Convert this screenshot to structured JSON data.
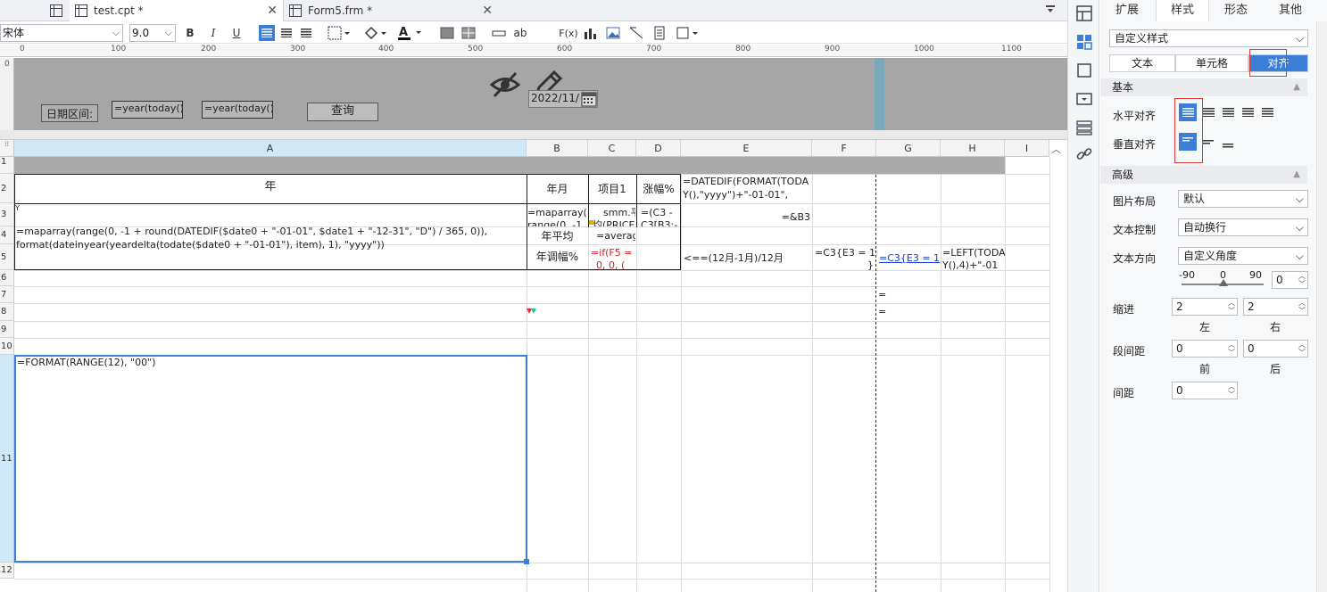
{
  "tabs": [
    {
      "label": "test.cpt *",
      "active": true
    },
    {
      "label": "Form5.frm *",
      "active": false
    }
  ],
  "toolbar": {
    "font_name": "宋体",
    "font_size": "9.0",
    "bold": "B",
    "italic": "I",
    "underline": "U",
    "text_tool": "ab",
    "formula_tool": "F(x)"
  },
  "ruler": {
    "marks": [
      "0",
      "100",
      "200",
      "300",
      "400",
      "500",
      "600",
      "700",
      "800",
      "900",
      "1000",
      "1100"
    ],
    "vmark": "0"
  },
  "parameter_pane": {
    "date_label": "日期区间:",
    "start_field": "=year(today()",
    "end_field": "=year(today()",
    "query_button": "查询",
    "date_widget_value": "2022/11/"
  },
  "sheet": {
    "columns": [
      "A",
      "B",
      "C",
      "D",
      "E",
      "F",
      "G",
      "H",
      "I"
    ],
    "rows": [
      "1",
      "2",
      "3",
      "4",
      "5",
      "6",
      "7",
      "8",
      "9",
      "10",
      "11",
      "12"
    ],
    "cells": {
      "a2": "年",
      "b2": "年月",
      "c2": "项目1",
      "d2": "涨幅%",
      "e2_l1": "=DATEDIF(FORMAT(TODA",
      "e2_l2": "Y(),\"yyyy\")+\"-01-01\",",
      "a3_mark": "Y",
      "a3_l1": "=maparray(range(0, -1 + round(DATEDIF($date0 + \"-01-01\", $date1 + \"-12-31\", \"D\") / 365, 0)),",
      "a3_l2": "format(dateinyear(yeardelta(todate($date0 + \"-01-01\"), item), 1), \"yyyy\"))",
      "b3_l1": "=maparray(",
      "b3_l2": "range(0, -1",
      "c3_l1": "smm.平",
      "c3_l2": "均(PRICE",
      "d3_l1": "=(C3 -",
      "d3_l2": "C3[B3:-",
      "e3": "=&B3",
      "b4": "年平均",
      "c4": "=averag",
      "b5": "年调幅%",
      "c5_l1": "=if(F5 =",
      "c5_l2": "0, 0, (",
      "e5": "<==(12月-1月)/12月",
      "f5_l1": "=C3{E3 = 12",
      "f5_l2": "}",
      "g5": "=C3{E3 = 1}",
      "h5_l1": "=LEFT(TODA",
      "h5_l2": "Y(),4)+\"-01",
      "g7": "=",
      "g8": "=",
      "a11": "=FORMAT(RANGE(12), \"00\")"
    }
  },
  "panel": {
    "tabs": [
      "扩展",
      "样式",
      "形态",
      "其他"
    ],
    "active_tab": "样式",
    "style_select": "自定义样式",
    "subtabs": [
      "文本",
      "单元格",
      "对齐"
    ],
    "active_subtab": "对齐",
    "section_basic": "基本",
    "h_align_label": "水平对齐",
    "v_align_label": "垂直对齐",
    "section_advanced": "高级",
    "image_layout_label": "图片布局",
    "image_layout_value": "默认",
    "text_control_label": "文本控制",
    "text_control_value": "自动换行",
    "text_direction_label": "文本方向",
    "text_direction_value": "自定义角度",
    "angle_min": "-90",
    "angle_mid": "0",
    "angle_max": "90",
    "angle_value": "0",
    "indent_label": "缩进",
    "indent_left": "2",
    "indent_right": "2",
    "left_label": "左",
    "right_label": "右",
    "para_spacing_label": "段间距",
    "para_before": "0",
    "para_after": "0",
    "before_label": "前",
    "after_label": "后",
    "spacing_label": "间距",
    "spacing_value": "0"
  },
  "colors": {
    "accent": "#3a7fd5",
    "highlight_red": "#e03b3b",
    "param_bg": "#a6a6a6",
    "selected_header": "#cfe9f8"
  }
}
